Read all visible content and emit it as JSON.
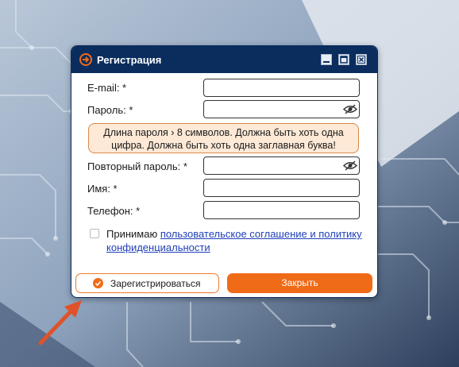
{
  "dialog": {
    "title": "Регистрация",
    "window_buttons": [
      "minimize",
      "maximize",
      "close"
    ]
  },
  "form": {
    "email_label": "E-mail: *",
    "password_label": "Пароль: *",
    "password_hint": "Длина пароля › 8 символов. Должна быть хоть одна цифра. Должна быть хоть одна заглавная буква!",
    "password_hint_line1": "Длина пароля › 8 символов. Должна быть хоть одна",
    "password_hint_line2": "цифра. Должна быть хоть одна заглавная буква!",
    "repeat_password_label": "Повторный пароль: *",
    "name_label": "Имя: *",
    "phone_label": "Телефон: *",
    "email_value": "",
    "password_value": "",
    "repeat_password_value": "",
    "name_value": "",
    "phone_value": ""
  },
  "agreement": {
    "checked": false,
    "prefix": "Принимаю",
    "link_text": "пользовательское соглашение и политику конфиденциальности"
  },
  "buttons": {
    "register": "Зарегистрироваться",
    "close": "Закрыть"
  },
  "colors": {
    "titlebar": "#0b2d5e",
    "accent": "#f06b18",
    "hint_bg": "#fde9d6",
    "link": "#1f3fb8"
  },
  "icons": [
    "logo-icon",
    "minimize-icon",
    "maximize-icon",
    "close-icon",
    "eye-icon",
    "checkmark-circle-icon",
    "arrow-pointer-icon"
  ]
}
